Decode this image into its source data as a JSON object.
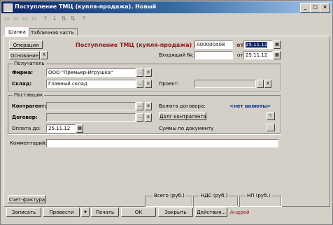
{
  "window": {
    "title": "Поступление ТМЦ (купля-продажа). Новый"
  },
  "tabs": [
    {
      "label": "Шапка"
    },
    {
      "label": "Табличная часть"
    }
  ],
  "header": {
    "operation_btn": "Операция",
    "doc_title": "Поступление ТМЦ (купля-продажа) №",
    "doc_number": "А00000408",
    "from_label": "от",
    "doc_date": "25.11.12",
    "basis_btn": "Основание",
    "incoming_label": "Входящий №:",
    "incoming_value": "",
    "incoming_from": "от",
    "incoming_date": "25.11.12"
  },
  "receiver": {
    "group_title": "Получатель",
    "firm_label": "Фирма:",
    "firm_value": "ООО \"Премьер-Игрушка\"",
    "warehouse_label": "Склад:",
    "warehouse_value": "Главный склад",
    "project_label": "Проект:",
    "project_value": ""
  },
  "supplier": {
    "group_title": "Поставщик",
    "counterparty_label": "Контрагент:",
    "counterparty_value": "",
    "contract_label": "Договор:",
    "contract_value": "",
    "pay_label": "Оплата до:",
    "pay_date": "25.11.12",
    "currency_label": "Валюта договора:",
    "currency_value": "<нет валюты>",
    "debt_btn": "Долг контрагента",
    "sum_label": "Суммы по документу"
  },
  "comment": {
    "label": "Комментарий:",
    "value": ""
  },
  "totals": {
    "total_label": "Всего (руб.)",
    "vat_label": "НДС (руб.)",
    "np_label": "НП (руб.)"
  },
  "footer": {
    "invoice_btn": "Счет-фактура",
    "record_btn": "Записать",
    "post_btn": "Провести",
    "print_btn": "Печать",
    "ok_btn": "ОК",
    "close_btn": "Закрыть",
    "actions_btn": "Действия...",
    "user": "Андрей"
  },
  "glyphs": {
    "ellipsis": "...",
    "x": "X",
    "dropdown": "▼",
    "close": "×",
    "min": "_",
    "max": "□",
    "calendar": "▦",
    "open": "о"
  }
}
